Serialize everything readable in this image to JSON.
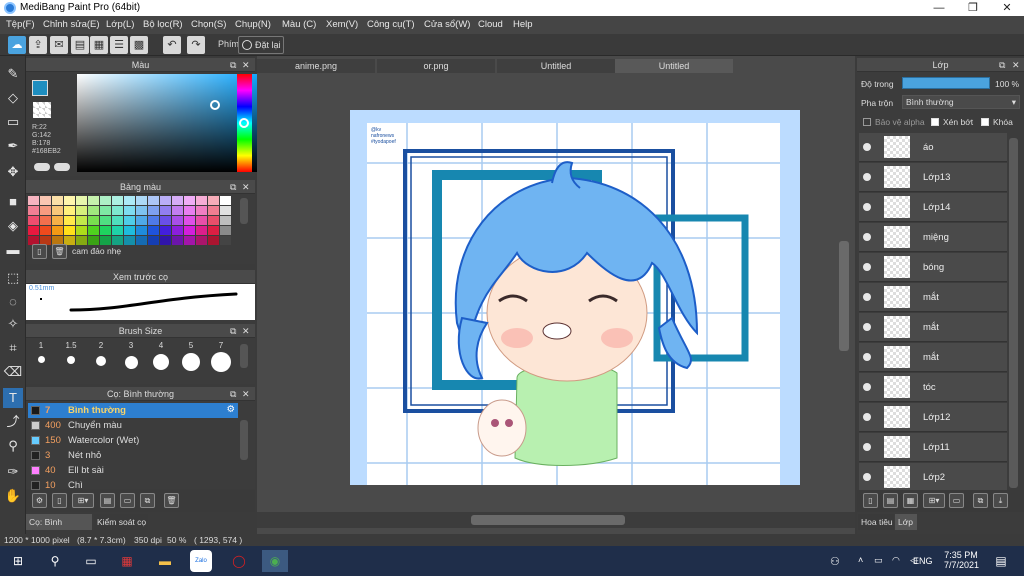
{
  "window": {
    "title": "MediBang Paint Pro (64bit)",
    "minimize": "—",
    "restore": "❐",
    "close": "✕"
  },
  "menu": [
    "Tệp(F)",
    "Chỉnh sửa(E)",
    "Lớp(L)",
    "Bộ lọc(R)",
    "Chọn(S)",
    "Chụp(N)",
    "Màu (C)",
    "Xem(V)",
    "Công cụ(T)",
    "Cửa sổ(W)",
    "Cloud",
    "Help"
  ],
  "toolbar": {
    "phim_label": "Phím",
    "reset_label": "Đặt lại"
  },
  "color_panel": {
    "title": "Màu",
    "r": "R:22",
    "g": "G:142",
    "b": "B:178",
    "hex": "#168EB2",
    "fg": "#1e8ec0",
    "bg": "#2a2a5a"
  },
  "palette_panel": {
    "title": "Bảng màu",
    "field_value": "cam đảo nhẹ",
    "colors": [
      "#f7b4c0",
      "#f9c6b2",
      "#fbe0a8",
      "#fff6ad",
      "#e7f7ad",
      "#c6f2ad",
      "#adf0c6",
      "#adf0e2",
      "#adeaf7",
      "#add9f7",
      "#adc6f7",
      "#b9adf7",
      "#d6adf7",
      "#f0adf7",
      "#f7add6",
      "#f7adb9",
      "#ffffff",
      "#f27f94",
      "#f69b80",
      "#f8c77a",
      "#fff07c",
      "#d6f07c",
      "#a0e87e",
      "#7ee8a4",
      "#7ee8d0",
      "#7edcf0",
      "#7ec2f0",
      "#7ea0f0",
      "#917ef0",
      "#c27ef0",
      "#e87ef0",
      "#f07ec2",
      "#f07e91",
      "#e0e0e0",
      "#ee4d6e",
      "#f26f4d",
      "#f5b047",
      "#ffe94a",
      "#c2e84a",
      "#78de4f",
      "#4fde82",
      "#4fdebd",
      "#4fcde8",
      "#4fa8e8",
      "#4f7ae8",
      "#6a4fe8",
      "#a84fe8",
      "#de4fe8",
      "#e84fa8",
      "#e84f6a",
      "#bdbdbd",
      "#e8193f",
      "#ee4a1d",
      "#f29a15",
      "#ffe01a",
      "#acdc1a",
      "#4fd21f",
      "#1fd25f",
      "#1fd2a8",
      "#1fbcdc",
      "#1f8bdc",
      "#1f53dc",
      "#431fdc",
      "#8b1fdc",
      "#d21fdc",
      "#dc1f8b",
      "#dc1f43",
      "#8a8a8a",
      "#b3122f",
      "#b83815",
      "#bb770f",
      "#c8ae12",
      "#85aa12",
      "#3aa315",
      "#15a348",
      "#15a382",
      "#1590aa",
      "#156bb3",
      "#153eb3",
      "#3015aa",
      "#6b15aa",
      "#a315aa",
      "#aa156b",
      "#aa1530",
      "#444444"
    ]
  },
  "brush_preview": {
    "title": "Xem trước cọ",
    "size": "0.51mm"
  },
  "brush_size": {
    "title": "Brush Size",
    "labels": [
      "1",
      "1.5",
      "2",
      "3",
      "4",
      "5",
      "7"
    ]
  },
  "brush_list": {
    "title": "Cọ: Bình thường",
    "items": [
      {
        "num": "7",
        "name": "Bình thường",
        "color": "#1a1a1a"
      },
      {
        "num": "400",
        "name": "Chuyển màu",
        "color": "#cccccc"
      },
      {
        "num": "150",
        "name": "Watercolor (Wet)",
        "color": "#66ccff"
      },
      {
        "num": "3",
        "name": "Nét nhỏ",
        "color": "#222222"
      },
      {
        "num": "40",
        "name": "Ell bt sài",
        "color": "#ff80ff"
      },
      {
        "num": "10",
        "name": "Chì",
        "color": "#222222"
      }
    ],
    "tab_brush": "Cọ: Bình thường",
    "tab_control": "Kiểm soát cọ"
  },
  "doc_tabs": [
    "anime.png",
    "or.png",
    "Untitled",
    "Untitled"
  ],
  "artwork": {
    "credit_lines": [
      "@kv",
      "nafronews",
      "#tyodapoef"
    ]
  },
  "layers_panel": {
    "title": "Lớp",
    "opacity_label": "Độ trong",
    "opacity_value": "100 %",
    "blend_label": "Pha trộn",
    "blend_value": "Bình thường",
    "protect_alpha": "Bảo vệ alpha",
    "clip": "Xén bớt",
    "lock": "Khóa",
    "layers": [
      "áo",
      "Lớp13",
      "Lớp14",
      "miệng",
      "bóng",
      "mắt",
      "mắt",
      "mắt",
      "tóc",
      "Lớp12",
      "Lớp11",
      "Lớp2"
    ],
    "tab_hoatieu": "Hoa tiêu",
    "tab_lop": "Lớp"
  },
  "status": {
    "size": "1200 * 1000 pixel",
    "dims": "(8.7 * 7.3cm)",
    "dpi": "350 dpi",
    "zoom": "50 %",
    "coords": "( 1293, 574 )"
  },
  "taskbar": {
    "lang": "ENG",
    "time": "7:35 PM",
    "date": "7/7/2021",
    "zalo": "Zalo"
  }
}
